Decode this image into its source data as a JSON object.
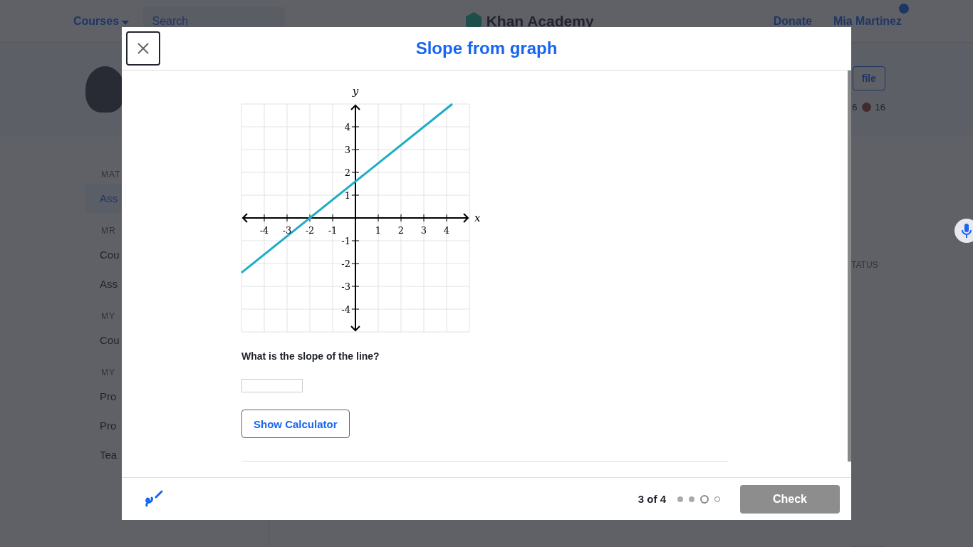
{
  "background_page": {
    "nav": {
      "courses": "Courses",
      "search": {
        "placeholder": "Search"
      },
      "logo": "Khan Academy",
      "donate": "Donate",
      "user": "Mia Martinez"
    },
    "profile": {
      "button": "file",
      "stats": [
        "6",
        "16"
      ]
    },
    "sidebar": {
      "sections": [
        {
          "heading": "MAT",
          "items": [
            {
              "label": "Ass",
              "selected": true
            }
          ]
        },
        {
          "heading": "MR",
          "items": [
            {
              "label": "Cou",
              "selected": false
            },
            {
              "label": "Ass",
              "selected": false
            }
          ]
        },
        {
          "heading": "MY",
          "items": [
            {
              "label": "Cou",
              "selected": false
            }
          ]
        },
        {
          "heading": "MY",
          "items": [
            {
              "label": "Pro",
              "selected": false
            },
            {
              "label": "Pro",
              "selected": false
            },
            {
              "label": "Tea",
              "selected": false
            }
          ]
        }
      ]
    },
    "table": {
      "column_heading": "TATUS"
    }
  },
  "modal": {
    "title": "Slope from graph",
    "chart_data": {
      "type": "line",
      "xlabel": "x",
      "ylabel": "y",
      "x": [
        -5,
        4.25
      ],
      "grid": true,
      "series": [
        {
          "color": "#1fabc9",
          "values": [
            -2.4,
            5
          ]
        }
      ],
      "xlim": [
        -5,
        5
      ],
      "ylim": [
        -5,
        5
      ],
      "xticks": [
        -4,
        -3,
        -2,
        -1,
        1,
        2,
        3,
        4
      ],
      "yticks": [
        -4,
        -3,
        -2,
        -1,
        1,
        2,
        3,
        4
      ]
    },
    "question": "What is the slope of the line?",
    "calculator_button": "Show Calculator",
    "footer": {
      "progress": "3 of 4",
      "steps": [
        {
          "kind": "done"
        },
        {
          "kind": "done"
        },
        {
          "kind": "current"
        },
        {
          "kind": "todo"
        }
      ],
      "check_button": "Check",
      "check_disabled": true
    }
  }
}
